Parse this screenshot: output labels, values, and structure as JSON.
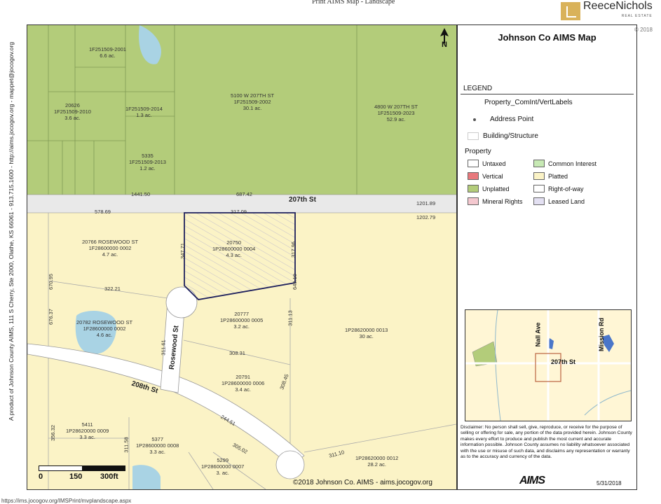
{
  "page": {
    "print_title": "Print AIMS Map - Landscape",
    "brand_name": "ReeceNichols",
    "brand_sub": "REAL ESTATE",
    "corner_copyright": "© 2018",
    "side_text": "A product of Johnson County AIMS, 111 S Cherry, Ste 2000, Olathe, KS 66061 - 913.715.1600 - http://aims.jocogov.org - mappet@jocogov.org",
    "bottom_url": "https://ims.jocogov.org/IMSPrint/mvplandscape.aspx"
  },
  "map": {
    "north_label": "N",
    "roads": {
      "road_207": "207th St",
      "road_208": "208th St",
      "rosewood": "Rosewood St"
    },
    "parcels": [
      {
        "id": "p-top-left",
        "text": "1F251509-2001\n6.6 ac."
      },
      {
        "id": "p-20826",
        "text": "20626\n1F251509-2010\n3.6 ac."
      },
      {
        "id": "p-2014",
        "text": "1F251509-2014\n1.3 ac."
      },
      {
        "id": "p-5335",
        "text": "5335\n1F251509-2013\n1.2 ac."
      },
      {
        "id": "p-5100",
        "text": "5100 W 207TH ST\n1F251509-2002\n30.1 ac."
      },
      {
        "id": "p-4800",
        "text": "4800 W 207TH ST\n1F251509-2023\n52.9 ac."
      },
      {
        "id": "p-20766",
        "text": "20766 ROSEWOOD ST\n1F28600000 0002\n4.7 ac."
      },
      {
        "id": "p-20750",
        "text": "20750\n1P28600000 0004\n4.3 ac."
      },
      {
        "id": "p-20782",
        "text": "20782 ROSEWOOD ST\n1F28600000 0002\n4.6 ac."
      },
      {
        "id": "p-20777",
        "text": "20777\n1P28600000 0005\n3.2 ac."
      },
      {
        "id": "p-0013",
        "text": "1P28620000 0013\n30 ac."
      },
      {
        "id": "p-20791",
        "text": "20791\n1P28600000 0006\n3.4 ac."
      },
      {
        "id": "p-5411",
        "text": "5411\n1P28620000 0009\n3.3 ac."
      },
      {
        "id": "p-5377",
        "text": "5377\n1P28600000 0008\n3.3 ac."
      },
      {
        "id": "p-5299",
        "text": "5299\n1P28600000 0007\n3. ac."
      },
      {
        "id": "p-0012",
        "text": "1P28620000 0012\n28.2 ac."
      }
    ],
    "dimensions": {
      "d1": "1441.50",
      "d2": "687.42",
      "d3": "1201.89",
      "d4": "578.69",
      "d5": "317.09",
      "d6": "1202.79",
      "d7": "347.71",
      "d8": "317.96",
      "d9": "322.21",
      "d10": "649.10",
      "d11": "670.95",
      "d12": "311.13",
      "d13": "676.37",
      "d14": "311.61",
      "d15": "308.31",
      "d16": "308.45",
      "d17": "244.51",
      "d18": "305.02",
      "d19": "311.10",
      "d20": "311.58",
      "d21": "356.32"
    },
    "scale": {
      "zero": "0",
      "mid": "150",
      "end": "300ft"
    },
    "footer_copyright": "©2018 Johnson Co. AIMS - aims.jocogov.org"
  },
  "legend": {
    "title": "Johnson Co AIMS Map",
    "heading": "LEGEND",
    "layers": [
      {
        "label": "Property_ComInt/VertLabels",
        "kind": "none"
      },
      {
        "label": "Address Point",
        "kind": "dot"
      },
      {
        "label": "Building/Structure",
        "kind": "box"
      }
    ],
    "property_heading": "Property",
    "property_items": [
      {
        "label": "Untaxed",
        "color": "#ffffff"
      },
      {
        "label": "Common Interest",
        "color": "#c7e9b4"
      },
      {
        "label": "Vertical",
        "color": "#e8787c"
      },
      {
        "label": "Platted",
        "color": "#fbf3c6"
      },
      {
        "label": "Unplatted",
        "color": "#b3cc7a"
      },
      {
        "label": "Right-of-way",
        "color": "#ffffff"
      },
      {
        "label": "Mineral Rights",
        "color": "#f4c8cf"
      },
      {
        "label": "Leased Land",
        "color": "#e3e0f2"
      }
    ]
  },
  "inset": {
    "nall": "Nall Ave",
    "mission": "Mission Rd",
    "road_207": "207th St"
  },
  "disclaimer": "Disclaimer: No person shall sell, give, reproduce, or receive for the purpose of selling or offering for sale, any portion of the data provided herein. Johnson County makes every effort to produce and publish the most current and accurate information possible. Johnson County assumes no liability whatsoever associated with the use or misuse of such data, and disclaims any representation or warranty as to the accuracy and currency of the data.",
  "aims": {
    "logo": "AIMS",
    "date": "5/31/2018"
  },
  "colors": {
    "unplatted": "#b3cc7a",
    "platted": "#fbf3c6",
    "water": "#a9d3e4",
    "subject_outline": "#1d1f5c",
    "road": "#e9e9e9"
  }
}
